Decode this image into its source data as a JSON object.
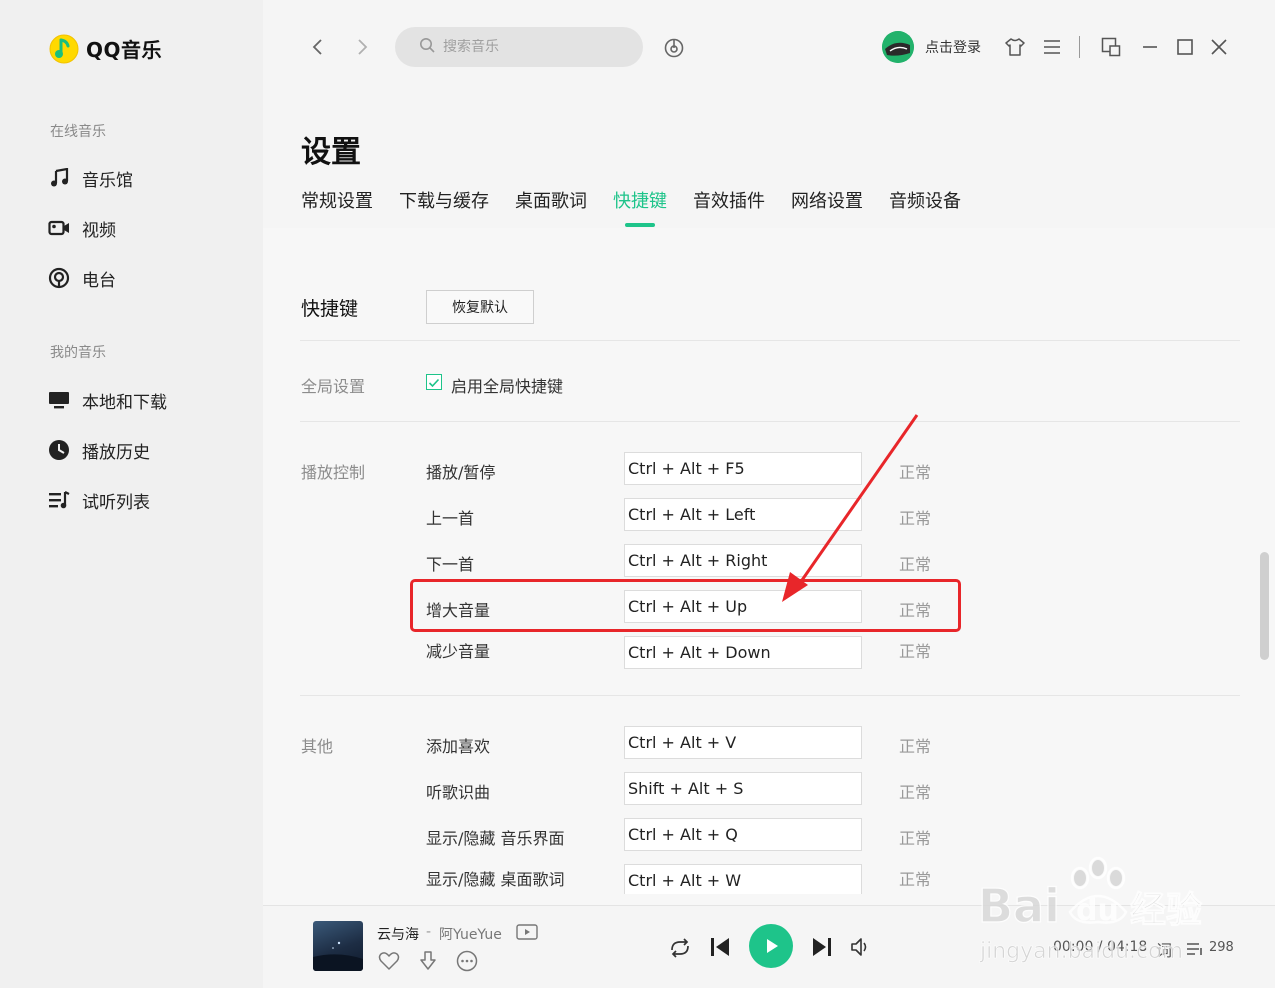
{
  "app": {
    "name": "QQ音乐",
    "accent": "#1ec48a"
  },
  "sidebar": {
    "sections": [
      {
        "title": "在线音乐",
        "items": [
          {
            "label": "音乐馆",
            "icon": "music-note-icon"
          },
          {
            "label": "视频",
            "icon": "video-icon"
          },
          {
            "label": "电台",
            "icon": "radio-icon"
          }
        ]
      },
      {
        "title": "我的音乐",
        "items": [
          {
            "label": "本地和下载",
            "icon": "monitor-icon"
          },
          {
            "label": "播放历史",
            "icon": "history-icon"
          },
          {
            "label": "试听列表",
            "icon": "playlist-icon"
          }
        ]
      }
    ]
  },
  "topbar": {
    "search_placeholder": "搜索音乐",
    "login_label": "点击登录"
  },
  "settings": {
    "title": "设置",
    "tabs": [
      "常规设置",
      "下载与缓存",
      "桌面歌词",
      "快捷键",
      "音效插件",
      "网络设置",
      "音频设备"
    ],
    "active_tab": "快捷键",
    "section_title": "快捷键",
    "restore_label": "恢复默认",
    "global": {
      "group": "全局设置",
      "option": "启用全局快捷键",
      "checked": true
    },
    "playback": {
      "group": "播放控制",
      "rows": [
        {
          "action": "播放/暂停",
          "keys": "Ctrl + Alt + F5",
          "status": "正常"
        },
        {
          "action": "上一首",
          "keys": "Ctrl + Alt + Left",
          "status": "正常"
        },
        {
          "action": "下一首",
          "keys": "Ctrl + Alt + Right",
          "status": "正常"
        },
        {
          "action": "增大音量",
          "keys": "Ctrl + Alt + Up",
          "status": "正常"
        },
        {
          "action": "减少音量",
          "keys": "Ctrl + Alt + Down",
          "status": "正常"
        }
      ]
    },
    "other": {
      "group": "其他",
      "rows": [
        {
          "action": "添加喜欢",
          "keys": "Ctrl + Alt + V",
          "status": "正常"
        },
        {
          "action": "听歌识曲",
          "keys": "Shift + Alt + S",
          "status": "正常"
        },
        {
          "action": "显示/隐藏 音乐界面",
          "keys": "Ctrl + Alt + Q",
          "status": "正常"
        },
        {
          "action": "显示/隐藏 桌面歌词",
          "keys": "Ctrl + Alt + W",
          "status": "正常"
        }
      ]
    }
  },
  "player": {
    "song": "云与海",
    "separator": "-",
    "artist": "阿YueYue",
    "time": "00:00 / 04:18",
    "lyric_label": "词",
    "playlist_count": "298"
  },
  "watermark": {
    "brand": "Bai",
    "brand2": "du",
    "cn": "经验",
    "url": "jingyan.baidu.com"
  }
}
